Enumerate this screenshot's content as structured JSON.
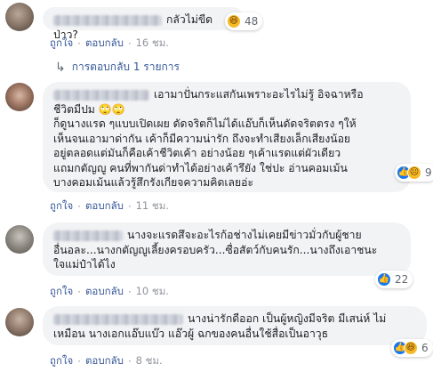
{
  "labels": {
    "like": "ถูกใจ",
    "reply": "ตอบกลับ"
  },
  "comments": [
    {
      "text": "กลัวไม่ขีดป่าว?",
      "reactions": {
        "icons": [
          "haha-icon"
        ],
        "count": "48"
      },
      "time": "16 ชม.",
      "replies": "การตอบกลับ 1 รายการ"
    },
    {
      "text_lines": [
        "เอามาปั่นกระแสกันเพราะอะไรไม่รู้ อิจฉาหรือ",
        "ชีวิตมีปม 🙄🙄",
        "ก็ดูนางแรด ๆแบบเปิดเผย ดัดจริตก็ไม่ได้แอ๊บก็เห็นดัดจริตตรง ๆให้",
        "เห็นจนเอามาด่ากัน เค้าก็มีความน่ารัก ถึงจะทำเสียงเล็กเสียงน้อย",
        "อยู่ตลอดแต่มันก็คือเค้าชีวิตเค้า อย่างน้อย ๆเค้าแรดแต่ผัวเดียว",
        "แถมกตัญญู คนที่พากันด่าทำได้อย่างเค้ารึยัง ใช่ปะ อ่านคอมเม้น",
        "บางคอมเม้นแล้วรู้สึกรังเกียจความคิดเลยอ่ะ"
      ],
      "reactions": {
        "icons": [
          "like-icon",
          "sad-icon"
        ],
        "count": "9"
      },
      "time": "11 ชม."
    },
    {
      "text_lines": [
        "นางจะแรดสึจะอะไรก้อช่างไม่เคยมีข่าวมั่วกับผู้ชาย",
        "อื่นอละ...นางกตัญญูเลี้ยงครอบครัว...ซื่อสัตว์กับคนรัก...นางถึงเอาชนะ",
        "ใจแม่ป๋าได้ไง"
      ],
      "reactions": {
        "icons": [
          "like-icon"
        ],
        "count": "22"
      },
      "time": "10 ชม."
    },
    {
      "text_lines": [
        "นางน่ารักดีออก เป็นผู้หญิงมีจริต มีเสน่ห์ ไม่",
        "เหมือน นางเอกแอ๊บแบ๊ว แอ๊วผู้ ฉกของคนอื่นใช้สื่อเป็นอาวุธ"
      ],
      "reactions": {
        "icons": [
          "like-icon",
          "haha-icon"
        ],
        "count": "6"
      },
      "time": "8 ชม."
    }
  ]
}
